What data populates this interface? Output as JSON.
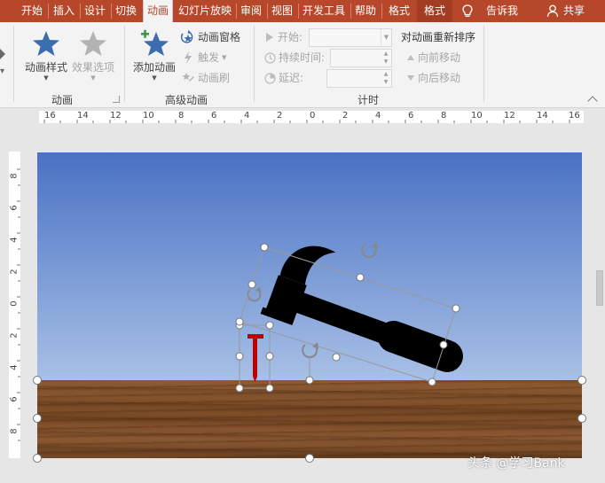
{
  "tabs": [
    {
      "label": "开始"
    },
    {
      "label": "插入"
    },
    {
      "label": "设计"
    },
    {
      "label": "切换"
    },
    {
      "label": "动画",
      "active": true
    },
    {
      "label": "幻灯片放映"
    },
    {
      "label": "审阅"
    },
    {
      "label": "视图"
    },
    {
      "label": "开发工具"
    },
    {
      "label": "帮助"
    },
    {
      "label": "格式"
    },
    {
      "label": "格式",
      "contextual": true
    }
  ],
  "tell_me": "告诉我",
  "share": "共享",
  "ribbon": {
    "animation_group": {
      "label": "动画",
      "animation_styles": "动画样式",
      "effect_options": "效果选项"
    },
    "advanced_group": {
      "label": "高级动画",
      "add_animation": "添加动画",
      "animation_pane": "动画窗格",
      "trigger": "触发",
      "animation_painter": "动画刷"
    },
    "timing_group": {
      "label": "计时",
      "start": "开始:",
      "duration": "持续时间:",
      "delay": "延迟:",
      "reorder": "对动画重新排序",
      "move_earlier": "向前移动",
      "move_later": "向后移动"
    }
  },
  "ruler": {
    "h_labels": [
      "16",
      "14",
      "12",
      "10",
      "8",
      "6",
      "4",
      "2",
      "0",
      "2",
      "4",
      "6",
      "8",
      "10",
      "12",
      "14",
      "16"
    ],
    "v_labels": [
      "8",
      "6",
      "4",
      "2",
      "0",
      "2",
      "4",
      "6",
      "8"
    ]
  },
  "colors": {
    "tab_bar": "#b7472a",
    "ribbon_bg": "#f3f3f3",
    "star_blue": "#3b6db0",
    "sky_top": "#4a72c4",
    "sky_bottom": "#a8c0e6",
    "nail_red": "#c00000"
  },
  "watermark": "头条 @学习Bank"
}
